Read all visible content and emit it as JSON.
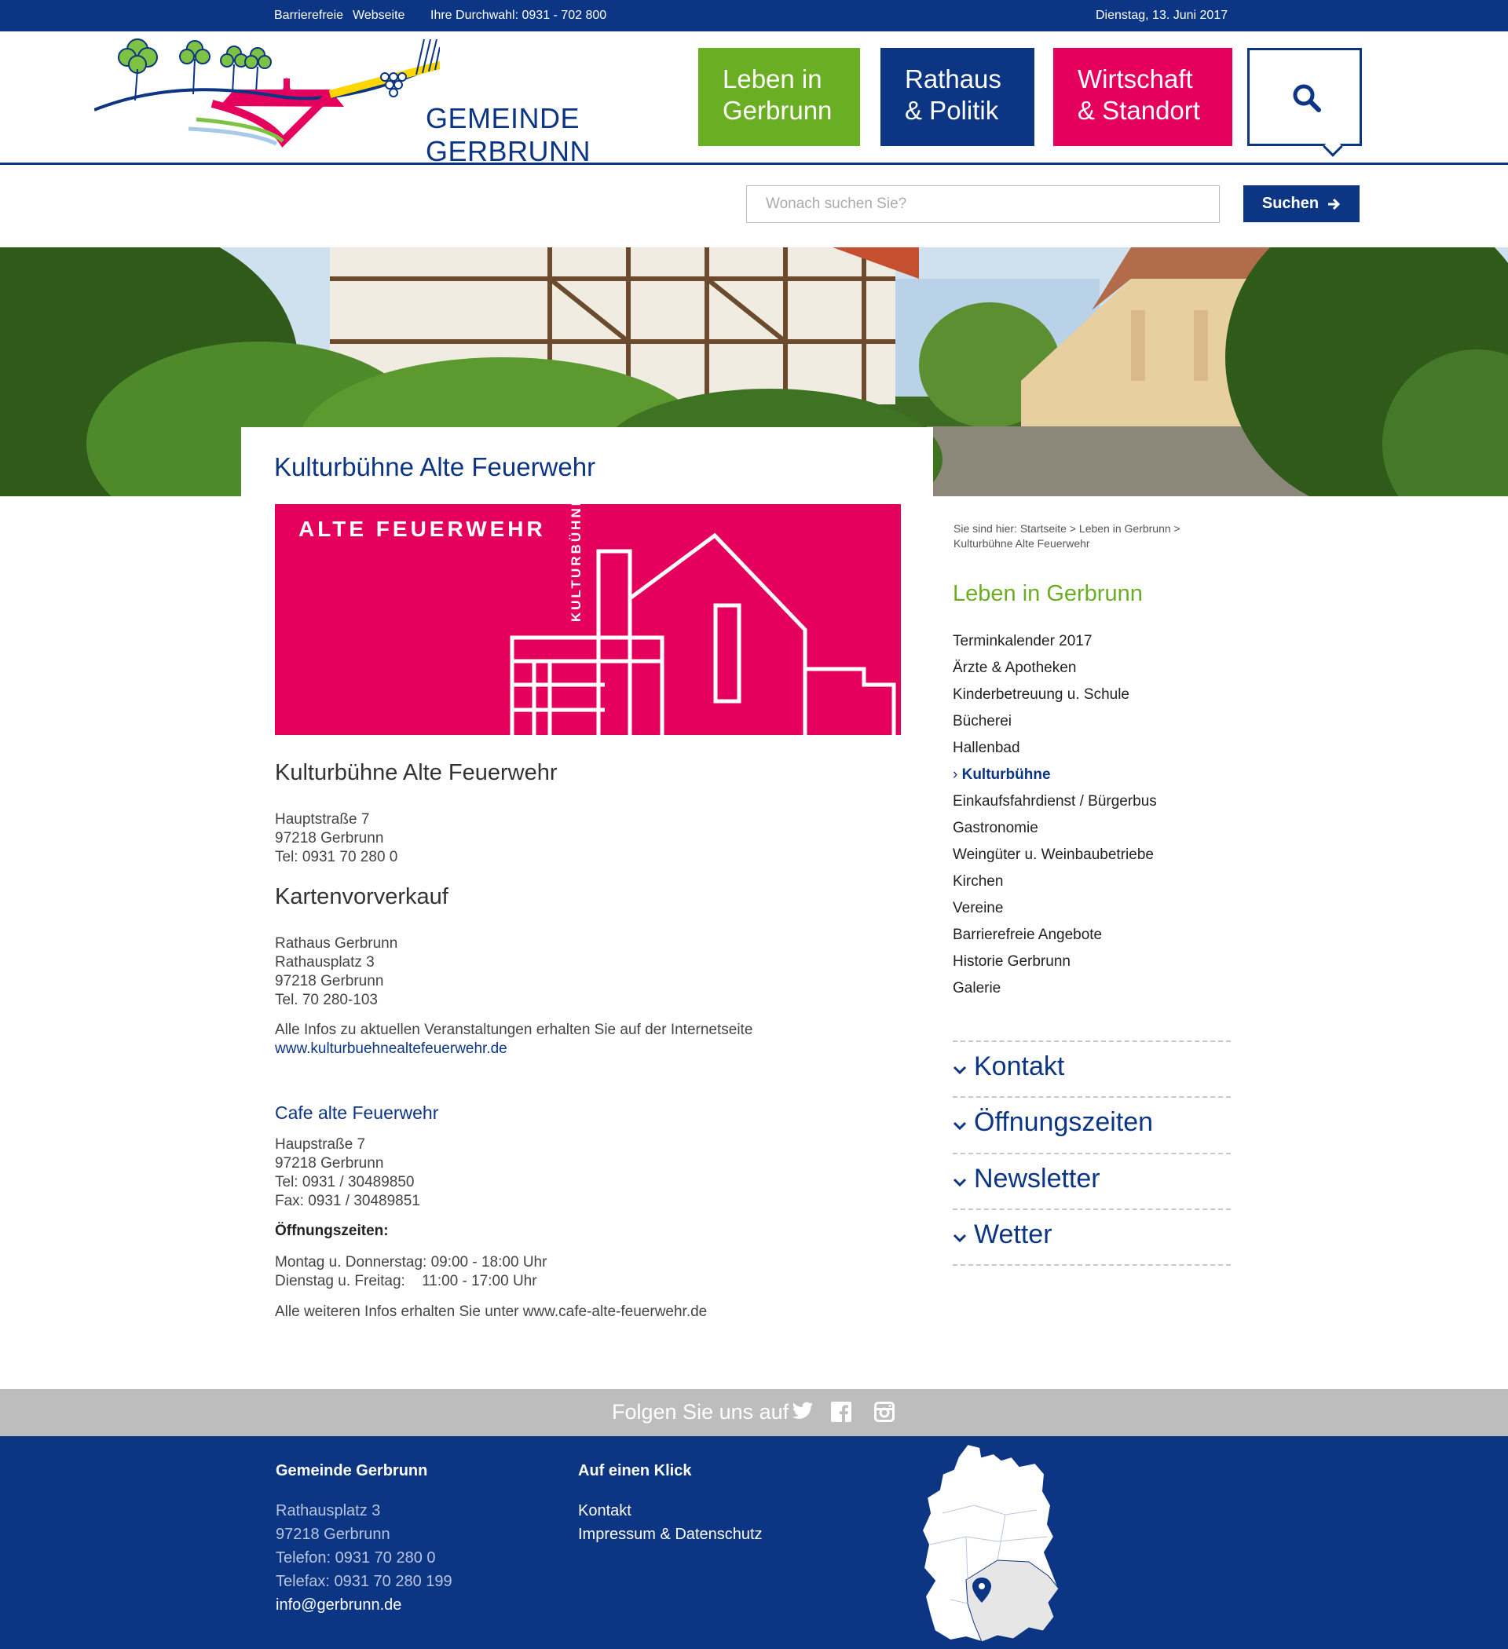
{
  "topbar": {
    "accessible": "Barrierefreie",
    "website": "Webseite",
    "phone": "Ihre Durchwahl: 0931 - 702 800",
    "date": "Dienstag, 13. Juni 2017"
  },
  "header": {
    "logo_text": "GEMEINDE GERBRUNN",
    "nav": [
      {
        "line1": "Leben in",
        "line2": "Gerbrunn",
        "color": "#6aaf23"
      },
      {
        "line1": "Rathaus",
        "line2": "& Politik",
        "color": "#0c3584"
      },
      {
        "line1": "Wirtschaft",
        "line2": "& Standort",
        "color": "#e5005e"
      }
    ],
    "search_icon": "search-icon"
  },
  "search": {
    "placeholder": "Wonach suchen Sie?",
    "button_label": "Suchen"
  },
  "page": {
    "title": "Kulturbühne Alte Feuerwehr",
    "banner_title": "ALTE FEUERWEHR",
    "banner_vertical": "KULTURBÜHNE",
    "section1_heading": "Kulturbühne Alte Feuerwehr",
    "section1_lines": [
      "Hauptstraße 7",
      "97218 Gerbrunn",
      "Tel: 0931 70 280 0"
    ],
    "section2_heading": "Kartenvorverkauf",
    "section2_lines": [
      "Rathaus Gerbrunn",
      "Rathausplatz 3",
      "97218 Gerbrunn",
      "Tel. 70 280-103"
    ],
    "info_text": "Alle Infos zu aktuellen Veranstaltungen erhalten Sie auf der Internetseite",
    "info_link": "www.kulturbuehnealtefeuerwehr.de",
    "cafe_heading": "Cafe alte Feuerwehr",
    "cafe_lines": [
      "Haupstraße 7",
      "97218 Gerbrunn",
      "Tel: 0931 / 30489850",
      "Fax: 0931 / 30489851"
    ],
    "hours_heading": "Öffnungszeiten:",
    "hours_1": "Montag u. Donnerstag: 09:00 - 18:00 Uhr",
    "hours_2_day": "Dienstag u. Freitag:",
    "hours_2_time": "11:00 - 17:00 Uhr",
    "cafe_more": "Alle weiteren Infos erhalten Sie unter www.cafe-alte-feuerwehr.de"
  },
  "sidebar": {
    "breadcrumb_1": "Sie sind hier: Startseite > Leben in Gerbrunn >",
    "breadcrumb_2": "Kulturbühne Alte Feuerwehr",
    "title": "Leben in Gerbrunn",
    "items": [
      "Terminkalender 2017",
      "Ärzte & Apotheken",
      "Kinderbetreuung u. Schule",
      "Bücherei",
      "Hallenbad",
      "Kulturbühne",
      "Einkaufsfahrdienst / Bürgerbus",
      "Gastronomie",
      "Weingüter u. Weinbaubetriebe",
      "Kirchen",
      "Vereine",
      "Barrierefreie Angebote",
      "Historie Gerbrunn",
      "Galerie"
    ],
    "active_item": "Kulturbühne",
    "accordions": [
      "Kontakt",
      "Öffnungszeiten",
      "Newsletter",
      "Wetter"
    ]
  },
  "follow": {
    "text": "Folgen Sie uns auf",
    "icons": [
      "twitter-icon",
      "facebook-icon",
      "instagram-icon"
    ]
  },
  "footer": {
    "col1_title": "Gemeinde Gerbrunn",
    "col1_lines": [
      "Rathausplatz 3",
      "97218 Gerbrunn",
      "Telefon: 0931 70 280 0",
      "Telefax: 0931 70 280 199"
    ],
    "col1_email": "info@gerbrunn.de",
    "col2_title": "Auf einen Klick",
    "col2_links": [
      "Kontakt",
      "Impressum & Datenschutz"
    ]
  },
  "colors": {
    "primary_blue": "#0c3584",
    "green": "#6aaf23",
    "magenta": "#e5005e",
    "gray_bar": "#bdbdbd"
  }
}
